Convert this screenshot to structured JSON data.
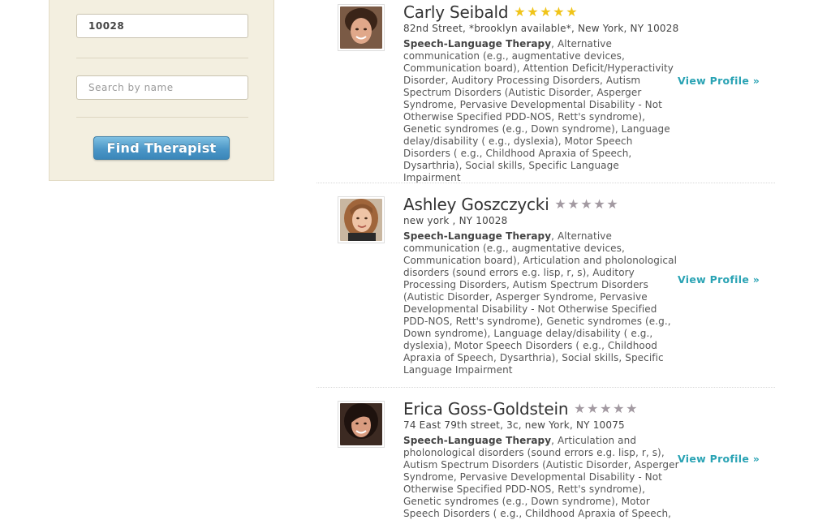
{
  "search": {
    "zip_value": "10028",
    "name_placeholder": "Search by name",
    "find_button_label": "Find Therapist"
  },
  "results": [
    {
      "name": "Carly Seibald",
      "rating": 5,
      "address": "82nd Street, *brooklyn available*, New York, NY 10028",
      "specialty": "Speech-Language Therapy",
      "description": ", Alternative communication (e.g., augmentative devices, Communication board), Attention Deficit/Hyperactivity Disorder, Auditory Processing Disorders, Autism Spectrum Disorders (Autistic Disorder, Asperger Syndrome, Pervasive Developmental Disability - Not Otherwise Specified PDD-NOS, Rett's syndrome), Genetic syndromes (e.g., Down syndrome), Language delay/disability ( e.g., dyslexia), Motor Speech Disorders ( e.g., Childhood Apraxia of Speech, Dysarthria), Social skills, Specific Language Impairment",
      "view_profile_label": "View Profile »"
    },
    {
      "name": "Ashley Goszczycki",
      "rating": 0,
      "address": "new york , NY 10028",
      "specialty": "Speech-Language Therapy",
      "description": ", Alternative communication (e.g., augmentative devices, Communication board), Articulation and pholonological disorders (sound errors e.g. lisp, r, s), Auditory Processing Disorders, Autism Spectrum Disorders (Autistic Disorder, Asperger Syndrome, Pervasive Developmental Disability - Not Otherwise Specified PDD-NOS, Rett's syndrome), Genetic syndromes (e.g., Down syndrome), Language delay/disability ( e.g., dyslexia), Motor Speech Disorders ( e.g., Childhood Apraxia of Speech, Dysarthria), Social skills, Specific Language Impairment",
      "view_profile_label": "View Profile »"
    },
    {
      "name": "Erica Goss-Goldstein",
      "rating": 0,
      "address": "74 East 79th street, 3c, new York, NY 10075",
      "specialty": "Speech-Language Therapy",
      "description": ", Articulation and pholonological disorders (sound errors e.g. lisp, r, s), Autism Spectrum Disorders (Autistic Disorder, Asperger Syndrome, Pervasive Developmental Disability - Not Otherwise Specified PDD-NOS, Rett's syndrome), Genetic syndromes (e.g., Down syndrome), Motor Speech Disorders ( e.g., Childhood Apraxia of Speech,",
      "view_profile_label": "View Profile »"
    }
  ],
  "colors": {
    "sidebar_bg": "#f3efe0",
    "button_blue": "#4c97c7",
    "link_teal": "#2aa3b4",
    "star_gold": "#f0c419",
    "star_gray": "#a39aa2"
  },
  "icons": {
    "star_filled": "star-icon",
    "star_empty": "star-icon"
  }
}
